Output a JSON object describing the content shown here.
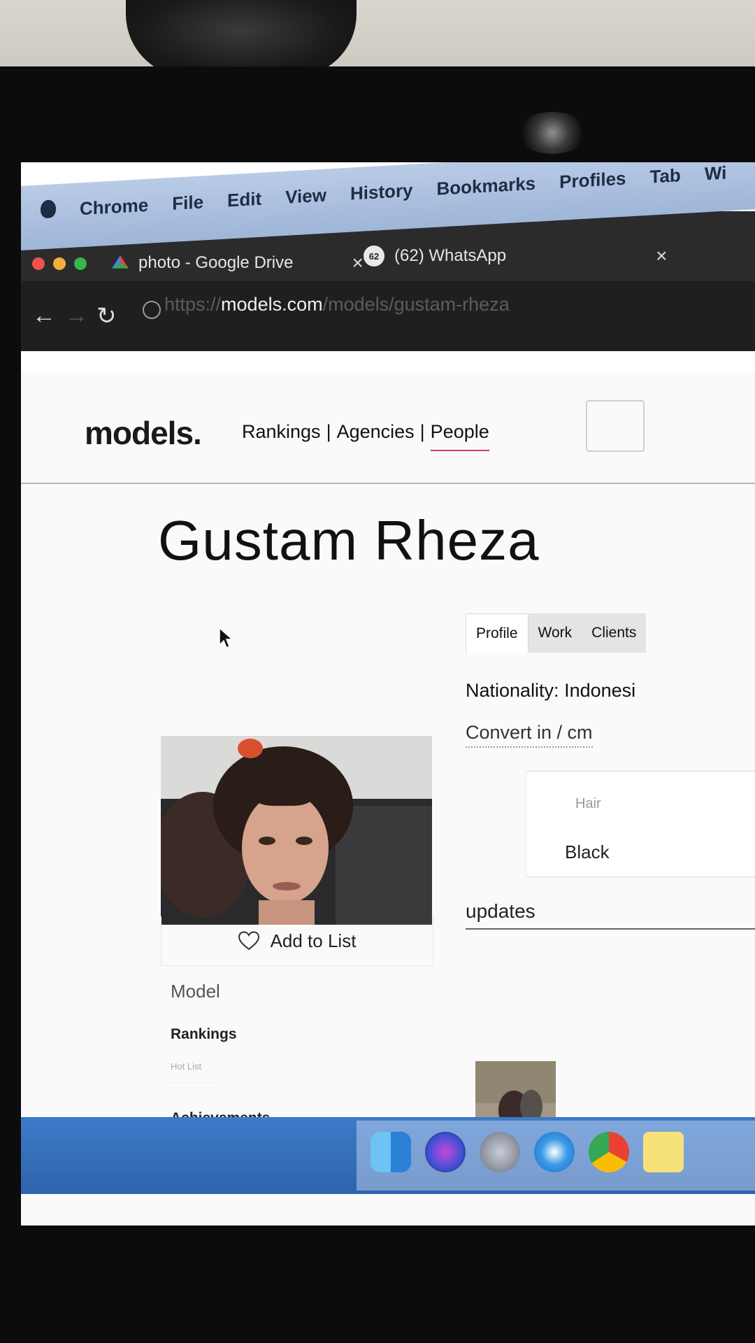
{
  "menubar": {
    "app": "Chrome",
    "items": [
      "File",
      "Edit",
      "View",
      "History",
      "Bookmarks",
      "Profiles",
      "Tab",
      "Wi"
    ]
  },
  "tabs": [
    {
      "title": "photo - Google Drive",
      "close": "×"
    },
    {
      "title": "(62) WhatsApp",
      "badge": "62",
      "close": "×"
    }
  ],
  "address_bar": {
    "scheme": "https://",
    "host": "models.com",
    "path": "/models/gustam-rheza"
  },
  "site": {
    "logo": "models.",
    "nav": {
      "rankings": "Rankings",
      "sep1": "|",
      "agencies": "Agencies",
      "sep2": "|",
      "people": "People"
    },
    "model_name": "Gustam Rheza",
    "profile_tabs": [
      "Profile",
      "Work",
      "Clients"
    ],
    "nationality": "Nationality: Indonesi",
    "convert_units": "Convert in / cm",
    "hair_label": "Hair",
    "hair_value": "Black",
    "updates_heading": "updates",
    "add_to_list": "Add to List",
    "role": "Model",
    "rankings_heading": "Rankings",
    "rankings_badge": "Hot List",
    "achievements_heading": "Achievements"
  },
  "colors": {
    "accent_underline": "#d33b6b",
    "menubar": "#b9cbe6",
    "dock": "#2f63ac"
  },
  "dock_icons": [
    "finder-icon",
    "siri-icon",
    "launchpad-icon",
    "safari-icon",
    "chrome-icon",
    "notes-icon"
  ]
}
